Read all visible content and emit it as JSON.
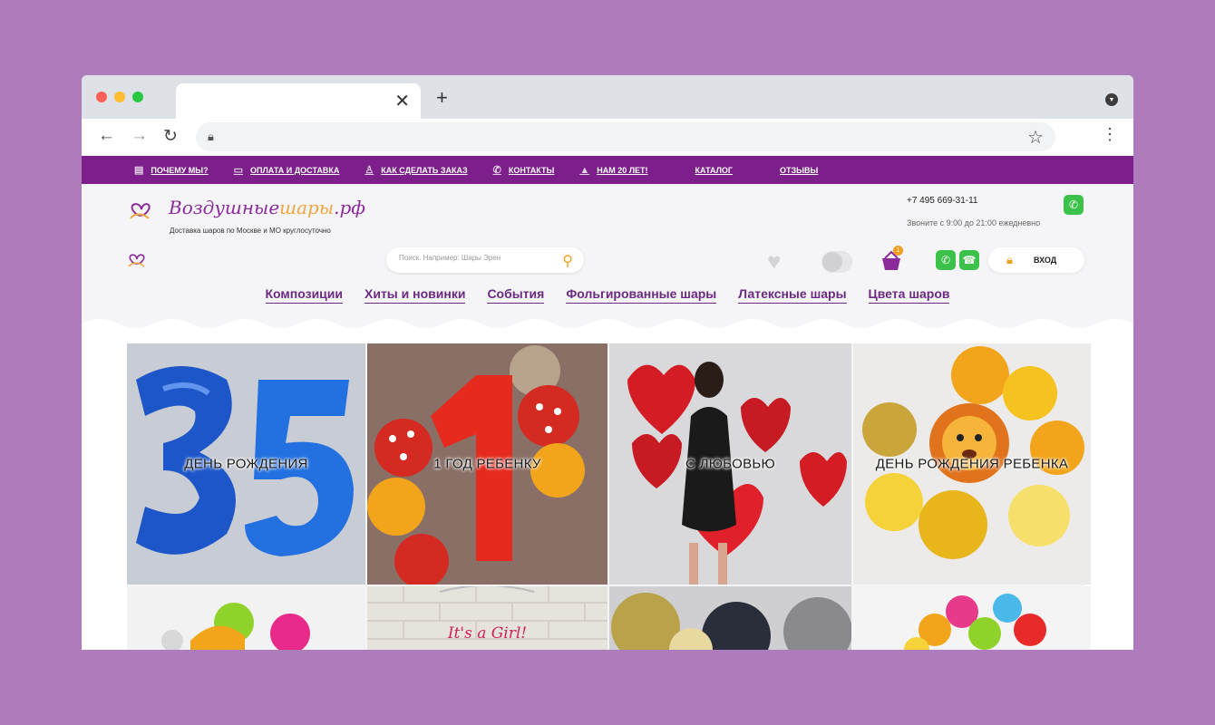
{
  "browser": {
    "tab_close": "✕",
    "new_tab": "+"
  },
  "topnav": [
    {
      "icon": "building-icon",
      "label": "ПОЧЕМУ МЫ?"
    },
    {
      "icon": "truck-icon",
      "label": "ОПЛАТА И ДОСТАВКА"
    },
    {
      "icon": "person-icon",
      "label": "КАК СДЕЛАТЬ ЗАКАЗ"
    },
    {
      "icon": "phone-icon",
      "label": "КОНТАКТЫ"
    },
    {
      "icon": "thumbs-up-icon",
      "label": "НАМ 20 ЛЕТ!"
    },
    {
      "icon": "",
      "label": "КАТАЛОГ"
    },
    {
      "icon": "",
      "label": "ОТЗЫВЫ"
    }
  ],
  "header": {
    "logo_main": "Воздушные",
    "logo_accent": "шары",
    "logo_tld": ".рф",
    "tagline": "Доставка шаров по Москве и МО круглосуточно",
    "phone": "+7 495 669-31-11",
    "hours": "Звоните с 9:00 до 21:00 ежедневно",
    "search_placeholder": "Поиск. Например: Шары Эрен",
    "cart_count": "1",
    "login": "ВХОД"
  },
  "categories": [
    "Композиции",
    "Хиты и новинки",
    "События",
    "Фольгированные шары",
    "Латексные шары",
    "Цвета шаров"
  ],
  "tiles": [
    {
      "label": "ДЕНЬ РОЖДЕНИЯ"
    },
    {
      "label": "1 ГОД РЕБЕНКУ"
    },
    {
      "label": "С ЛЮБОВЬЮ"
    },
    {
      "label": "ДЕНЬ РОЖДЕНИЯ РЕБЕНКА"
    }
  ],
  "row2": {
    "its_a_girl": "It's a Girl!"
  },
  "colors": {
    "brand_purple": "#7c1f8a",
    "accent_orange": "#f0a020",
    "whatsapp_green": "#3cc24a"
  }
}
